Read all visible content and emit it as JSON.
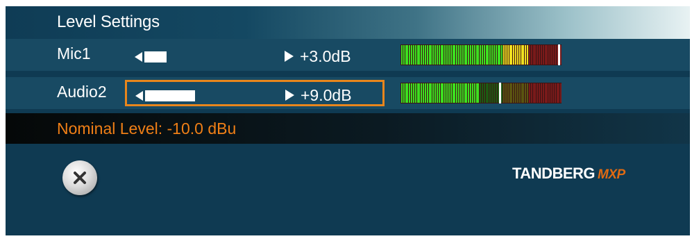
{
  "window": {
    "title": "Level Settings"
  },
  "channels": [
    {
      "label": "Mic1",
      "gain": "+3.0dB",
      "slider_level": 0.18,
      "selected": false,
      "meter": {
        "green_segments": 52,
        "yellow_segments": 13,
        "dark_segments": 17,
        "lit_segments": 65,
        "peak_position": 0.985
      }
    },
    {
      "label": "Audio2",
      "gain": "+9.0dB",
      "slider_level": 0.4,
      "selected": true,
      "meter": {
        "green_segments": 52,
        "yellow_segments": 13,
        "dark_segments": 17,
        "lit_segments": 40,
        "peak_position": 0.62
      }
    }
  ],
  "nominal": {
    "text": "Nominal Level: -10.0 dBu"
  },
  "close": {
    "icon": "close-icon"
  },
  "logo": {
    "brand": "TANDBERG",
    "product": "MXP"
  },
  "colors": {
    "accent": "#e8861c",
    "meter_green": "#3ce020",
    "meter_yellow": "#f0e020",
    "meter_red": "#7a1a1a",
    "nominal_text": "#f07f16"
  }
}
